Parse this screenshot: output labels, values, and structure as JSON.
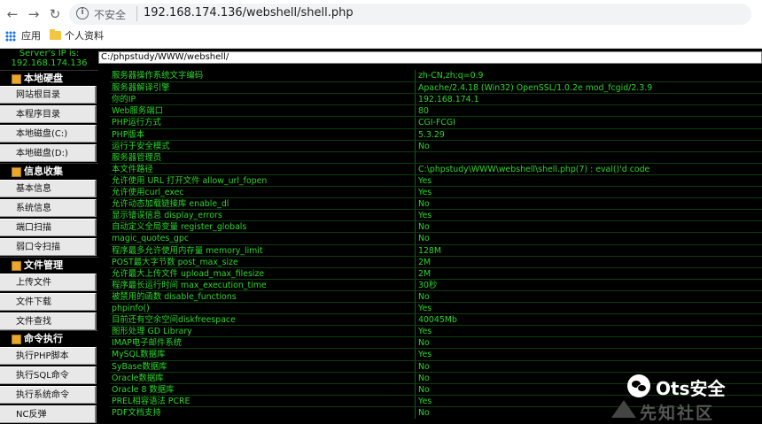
{
  "browser": {
    "back_icon": "arrow-left-icon",
    "forward_icon": "arrow-right-icon",
    "reload_icon": "reload-icon",
    "security_label": "不安全",
    "url": "192.168.174.136/webshell/shell.php",
    "bookmarks": [
      "应用",
      "个人资料"
    ]
  },
  "sidebar": {
    "server_ip_label": "Server's IP is:",
    "server_ip": "192.168.174.136",
    "sections": [
      {
        "title": "本地硬盘",
        "items": [
          "网站根目录",
          "本程序目录",
          "本地磁盘(C:)",
          "本地磁盘(D:)"
        ]
      },
      {
        "title": "信息收集",
        "items": [
          "基本信息",
          "系统信息",
          "端口扫描",
          "弱口令扫描"
        ]
      },
      {
        "title": "文件管理",
        "items": [
          "上传文件",
          "文件下载",
          "文件查找"
        ]
      },
      {
        "title": "命令执行",
        "items": [
          "执行PHP脚本",
          "执行SQL命令",
          "执行系统命令",
          "NC反弹"
        ]
      }
    ]
  },
  "path": "C:/phpstudy/WWW/webshell/",
  "info_rows": [
    {
      "k": "服务器操作系统文字编码",
      "v": "zh-CN,zh;q=0.9"
    },
    {
      "k": "服务器解译引擎",
      "v": "Apache/2.4.18 (Win32) OpenSSL/1.0.2e mod_fcgid/2.3.9"
    },
    {
      "k": "你的IP",
      "v": "192.168.174.1"
    },
    {
      "k": "Web服务端口",
      "v": "80"
    },
    {
      "k": "PHP运行方式",
      "v": "CGI-FCGI"
    },
    {
      "k": "PHP版本",
      "v": "5.3.29"
    },
    {
      "k": "运行于安全模式",
      "v": "No"
    },
    {
      "k": "服务器管理员",
      "v": ""
    },
    {
      "k": "本文件路径",
      "v": "C:\\phpstudy\\WWW\\webshell\\shell.php(7) : eval()'d code"
    },
    {
      "k": "允许使用 URL 打开文件 allow_url_fopen",
      "v": "Yes"
    },
    {
      "k": "允许使用curl_exec",
      "v": "Yes"
    },
    {
      "k": "允许动态加载链接库 enable_dl",
      "v": "No"
    },
    {
      "k": "显示错误信息 display_errors",
      "v": "Yes"
    },
    {
      "k": "自动定义全局变量 register_globals",
      "v": "No"
    },
    {
      "k": "magic_quotes_gpc",
      "v": "No"
    },
    {
      "k": "程序最多允许使用内存量 memory_limit",
      "v": "128M"
    },
    {
      "k": "POST最大字节数 post_max_size",
      "v": "2M"
    },
    {
      "k": "允许最大上传文件 upload_max_filesize",
      "v": "2M"
    },
    {
      "k": "程序最长运行时间 max_execution_time",
      "v": "30秒"
    },
    {
      "k": "被禁用的函数 disable_functions",
      "v": "No"
    },
    {
      "k": "phpinfo()",
      "v": "Yes"
    },
    {
      "k": "目前还有空余空间diskfreespace",
      "v": "40045Mb"
    },
    {
      "k": "图形处理 GD Library",
      "v": "Yes"
    },
    {
      "k": "IMAP电子邮件系统",
      "v": "No"
    },
    {
      "k": "MySQL数据库",
      "v": "Yes"
    },
    {
      "k": "SyBase数据库",
      "v": "No"
    },
    {
      "k": "Oracle数据库",
      "v": "No"
    },
    {
      "k": "Oracle 8 数据库",
      "v": "No"
    },
    {
      "k": "PREL相容语法 PCRE",
      "v": "Yes"
    },
    {
      "k": "PDF文档支持",
      "v": "No"
    }
  ],
  "watermark": {
    "brand": "Ots安全",
    "sub": "先知社区"
  }
}
